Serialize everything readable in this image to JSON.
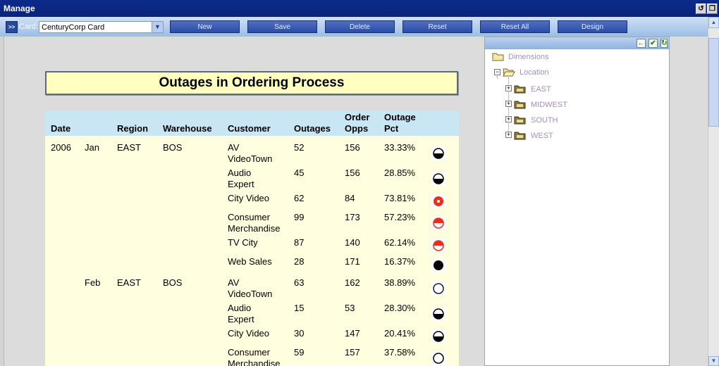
{
  "window": {
    "title": "Manage"
  },
  "toolbar": {
    "card_label": "Card:",
    "card_value": "CenturyCorp Card",
    "buttons": [
      "New",
      "Save",
      "Delete",
      "Reset",
      "Reset All",
      "Design"
    ]
  },
  "report": {
    "title": "Outages in Ordering Process",
    "headers": {
      "date": "Date",
      "region": "Region",
      "warehouse": "Warehouse",
      "customer": "Customer",
      "outages": "Outages",
      "order_opps_1": "Order",
      "order_opps_2": "Opps",
      "outage_pct_1": "Outage",
      "outage_pct_2": "Pct"
    },
    "rows": [
      {
        "year": "2006",
        "month": "Jan",
        "region": "EAST",
        "warehouse": "BOS",
        "customer": [
          "AV",
          "VideoTown"
        ],
        "outages": "52",
        "order_opps": "156",
        "pct": "33.33%",
        "indicator": "half",
        "color": "#000000"
      },
      {
        "year": "",
        "month": "",
        "region": "",
        "warehouse": "",
        "customer": [
          "Audio",
          "Expert"
        ],
        "outages": "45",
        "order_opps": "156",
        "pct": "28.85%",
        "indicator": "half",
        "color": "#000000"
      },
      {
        "year": "",
        "month": "",
        "region": "",
        "warehouse": "",
        "customer": [
          "City Video",
          ""
        ],
        "outages": "62",
        "order_opps": "84",
        "pct": "73.81%",
        "indicator": "full-ring",
        "color": "#e8301c"
      },
      {
        "year": "",
        "month": "",
        "region": "",
        "warehouse": "",
        "customer": [
          "Consumer",
          "Merchandise"
        ],
        "outages": "99",
        "order_opps": "173",
        "pct": "57.23%",
        "indicator": "half-top",
        "color": "#e8301c"
      },
      {
        "year": "",
        "month": "",
        "region": "",
        "warehouse": "",
        "customer": [
          "TV City",
          ""
        ],
        "outages": "87",
        "order_opps": "140",
        "pct": "62.14%",
        "indicator": "half-top",
        "color": "#e8301c"
      },
      {
        "year": "",
        "month": "",
        "region": "",
        "warehouse": "",
        "customer": [
          "Web Sales",
          ""
        ],
        "outages": "28",
        "order_opps": "171",
        "pct": "16.37%",
        "indicator": "full",
        "color": "#000000"
      },
      {
        "year": "",
        "month": "Feb",
        "region": "EAST",
        "warehouse": "BOS",
        "customer": [
          "AV",
          "VideoTown"
        ],
        "outages": "63",
        "order_opps": "162",
        "pct": "38.89%",
        "indicator": "empty",
        "color": "#1a1a3a"
      },
      {
        "year": "",
        "month": "",
        "region": "",
        "warehouse": "",
        "customer": [
          "Audio",
          "Expert"
        ],
        "outages": "15",
        "order_opps": "53",
        "pct": "28.30%",
        "indicator": "half",
        "color": "#000000"
      },
      {
        "year": "",
        "month": "",
        "region": "",
        "warehouse": "",
        "customer": [
          "City Video",
          ""
        ],
        "outages": "30",
        "order_opps": "147",
        "pct": "20.41%",
        "indicator": "half",
        "color": "#000000"
      },
      {
        "year": "",
        "month": "",
        "region": "",
        "warehouse": "",
        "customer": [
          "Consumer",
          "Merchandise"
        ],
        "outages": "59",
        "order_opps": "157",
        "pct": "37.58%",
        "indicator": "empty",
        "color": "#000000"
      }
    ]
  },
  "dimensions": {
    "root": "Dimensions",
    "location": "Location",
    "regions": [
      "EAST",
      "MIDWEST",
      "SOUTH",
      "WEST"
    ],
    "icons": [
      "arrow-left-icon",
      "check-icon",
      "refresh-icon"
    ]
  }
}
